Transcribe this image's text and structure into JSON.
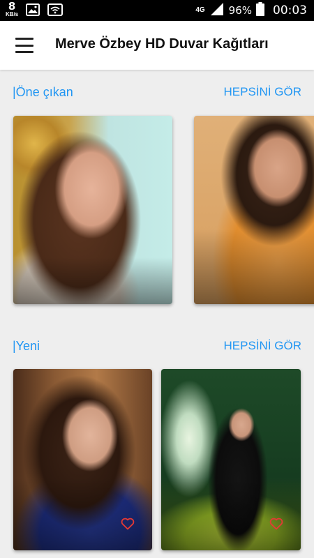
{
  "status_bar": {
    "net_speed": "8",
    "net_speed_unit": "KB/s",
    "network_type": "4G",
    "battery": "96%",
    "time": "00:03",
    "icons": [
      "image-icon",
      "wifi-icon",
      "signal-icon",
      "battery-icon"
    ]
  },
  "app_bar": {
    "title": "Merve Özbey HD Duvar Kağıtları",
    "menu_icon": "hamburger-menu-icon"
  },
  "sections": {
    "featured": {
      "label": "|Öne çıkan",
      "see_all": "HEPSİNİ GÖR"
    },
    "new": {
      "label": "|Yeni",
      "see_all": "HEPSİNİ GÖR"
    }
  },
  "colors": {
    "accent": "#2196f3",
    "heart": "#e53935"
  }
}
